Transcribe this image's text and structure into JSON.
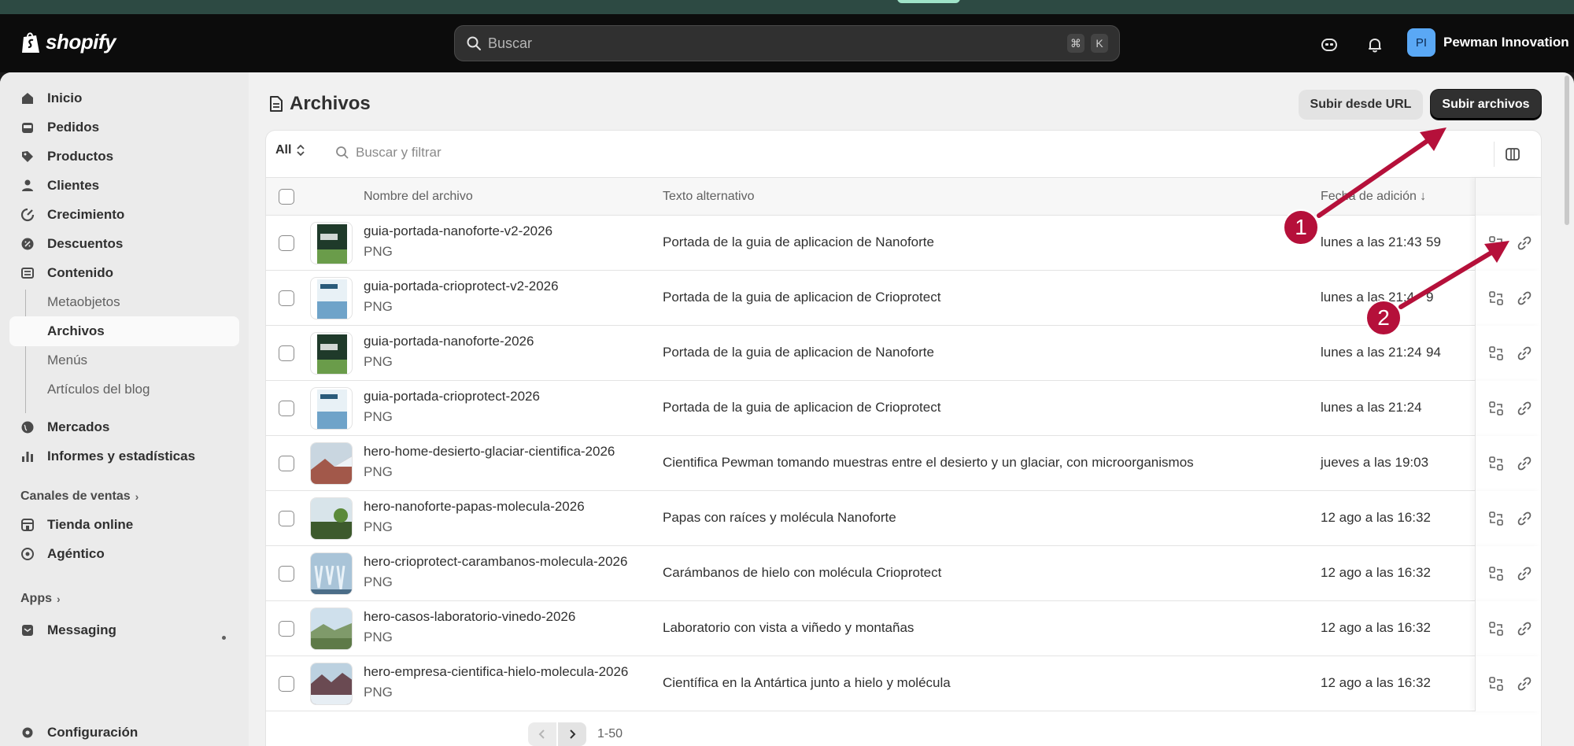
{
  "topbar": {
    "logo_text": "shopify",
    "search_placeholder": "Buscar",
    "shortcut_cmd": "⌘",
    "shortcut_key": "K",
    "store_initials": "PI",
    "store_name": "Pewman Innovation"
  },
  "sidebar": {
    "items": {
      "inicio": "Inicio",
      "pedidos": "Pedidos",
      "productos": "Productos",
      "clientes": "Clientes",
      "crecimiento": "Crecimiento",
      "descuentos": "Descuentos",
      "contenido": "Contenido",
      "metaobjetos": "Metaobjetos",
      "archivos": "Archivos",
      "menus": "Menús",
      "articulos": "Artículos del blog",
      "mercados": "Mercados",
      "informes": "Informes y estadísticas",
      "tienda": "Tienda online",
      "agentico": "Agéntico",
      "messaging": "Messaging",
      "configuracion": "Configuración"
    },
    "canales_title": "Canales de ventas",
    "apps_title": "Apps"
  },
  "page": {
    "title": "Archivos",
    "upload_url_label": "Subir desde URL",
    "upload_files_label": "Subir archivos"
  },
  "filter": {
    "view": "All",
    "search_placeholder": "Buscar y filtrar"
  },
  "table": {
    "headers": {
      "name": "Nombre del archivo",
      "alt": "Texto alternativo",
      "date": "Fecha de adición ↓"
    },
    "rows": [
      {
        "name": "guia-portada-nanoforte-v2-2026",
        "type": "PNG",
        "alt": "Portada de la guia de aplicacion de Nanoforte",
        "date": "lunes a las 21:43",
        "size": "59"
      },
      {
        "name": "guia-portada-crioprotect-v2-2026",
        "type": "PNG",
        "alt": "Portada de la guia de aplicacion de Crioprotect",
        "date": "lunes a las 21:4",
        "size": "9"
      },
      {
        "name": "guia-portada-nanoforte-2026",
        "type": "PNG",
        "alt": "Portada de la guia de aplicacion de Nanoforte",
        "date": "lunes a las 21:24",
        "size": "94"
      },
      {
        "name": "guia-portada-crioprotect-2026",
        "type": "PNG",
        "alt": "Portada de la guia de aplicacion de Crioprotect",
        "date": "lunes a las 21:24",
        "size": ""
      },
      {
        "name": "hero-home-desierto-glaciar-cientifica-2026",
        "type": "PNG",
        "alt": "Cientifica Pewman tomando muestras entre el desierto y un glaciar, con microorganismos",
        "date": "jueves a las 19:03",
        "size": ""
      },
      {
        "name": "hero-nanoforte-papas-molecula-2026",
        "type": "PNG",
        "alt": "Papas con raíces y molécula Nanoforte",
        "date": "12 ago a las 16:32",
        "size": ""
      },
      {
        "name": "hero-crioprotect-carambanos-molecula-2026",
        "type": "PNG",
        "alt": "Carámbanos de hielo con molécula Crioprotect",
        "date": "12 ago a las 16:32",
        "size": ""
      },
      {
        "name": "hero-casos-laboratorio-vinedo-2026",
        "type": "PNG",
        "alt": "Laboratorio con vista a viñedo y montañas",
        "date": "12 ago a las 16:32",
        "size": ""
      },
      {
        "name": "hero-empresa-cientifica-hielo-molecula-2026",
        "type": "PNG",
        "alt": "Científica en la Antártica junto a hielo y molécula",
        "date": "12 ago a las 16:32",
        "size": ""
      }
    ]
  },
  "pagination": {
    "range": "1-50"
  },
  "annotations": {
    "one": "1",
    "two": "2"
  },
  "colors": {
    "annotation": "#b5103a",
    "primary_button": "#303030",
    "topbar": "#0c0c0c",
    "avatar": "#5aa8f5"
  }
}
